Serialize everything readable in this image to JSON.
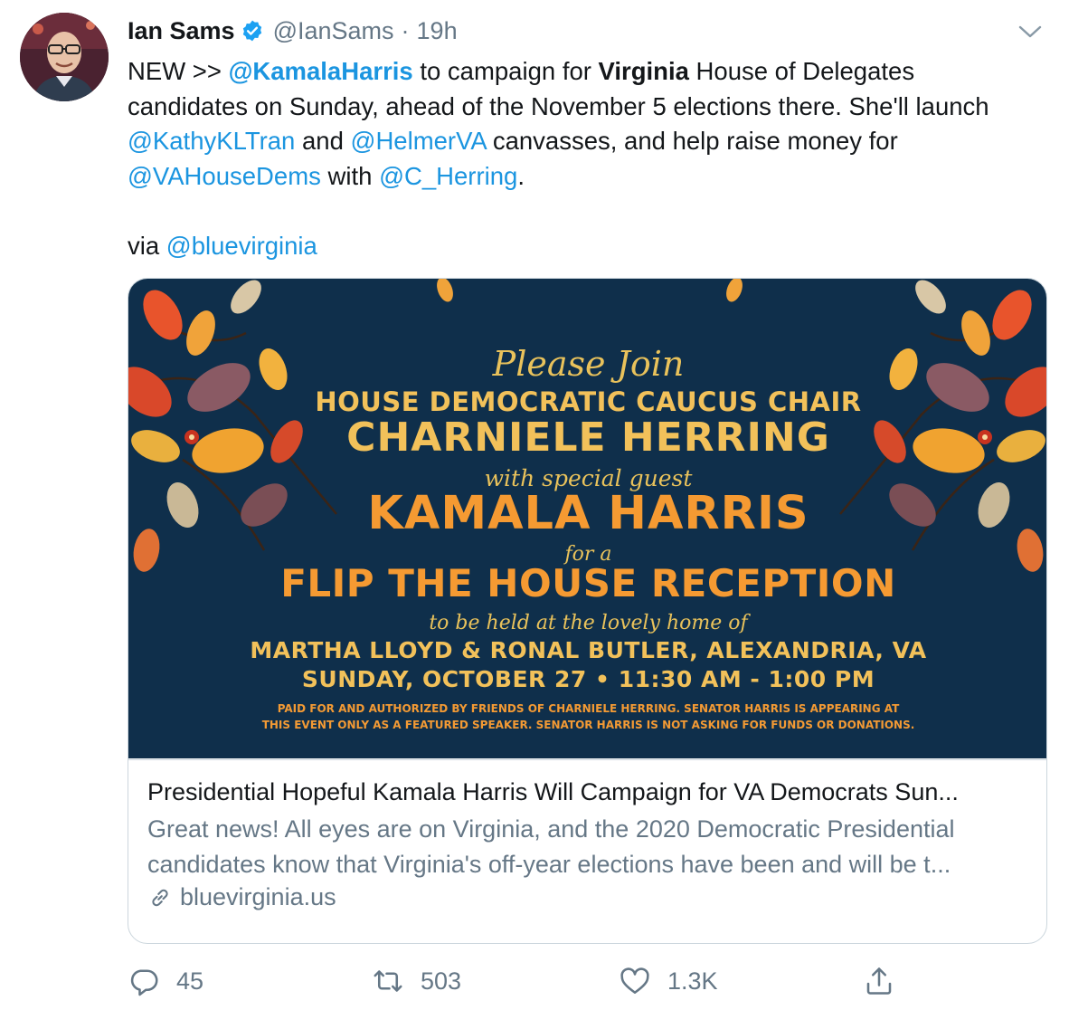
{
  "tweet": {
    "author": {
      "name": "Ian Sams",
      "handle": "@IanSams",
      "time": "19h"
    },
    "lines": {
      "l1": {
        "a": "NEW >> ",
        "mention1": "@KamalaHarris",
        "b": " to campaign for ",
        "bold": "Virginia",
        "c": " House of Delegates"
      },
      "l2": "candidates on Sunday, ahead of the November 5 elections there. She'll launch",
      "l3": {
        "mention1": "@KathyKLTran",
        "a": " and ",
        "mention2": "@HelmerVA",
        "b": " canvasses, and help raise money for"
      },
      "l4": {
        "mention1": "@VAHouseDems",
        "a": " with ",
        "mention2": "@C_Herring",
        "b": "."
      },
      "l5": {
        "a": "via ",
        "mention1": "@bluevirginia"
      }
    }
  },
  "flyer": {
    "please_join": "Please Join",
    "caucus_chair": "HOUSE DEMOCRATIC CAUCUS CHAIR",
    "host": "CHARNIELE HERRING",
    "special_guest": "with special guest",
    "guest": "KAMALA HARRIS",
    "for_a": "for a",
    "event": "FLIP THE HOUSE RECEPTION",
    "held_at": "to be held at the lovely home of",
    "hosts_home": "MARTHA LLOYD & RONAL BUTLER, ALEXANDRIA, VA",
    "datetime": "SUNDAY, OCTOBER 27 • 11:30 AM - 1:00 PM",
    "disclaimer1": "PAID FOR AND AUTHORIZED BY FRIENDS OF CHARNIELE HERRING. SENATOR HARRIS IS APPEARING AT",
    "disclaimer2": "THIS EVENT ONLY AS A FEATURED SPEAKER. SENATOR HARRIS IS NOT ASKING FOR FUNDS OR DONATIONS."
  },
  "card": {
    "title": "Presidential Hopeful Kamala Harris Will Campaign for VA Democrats Sun...",
    "desc1": "Great news! All eyes are on Virginia, and the 2020 Democratic Presidential",
    "desc2": "candidates know that Virginia's off-year elections have been and will be t...",
    "domain": "bluevirginia.us"
  },
  "actions": {
    "replies": "45",
    "retweets": "503",
    "likes": "1.3K"
  },
  "colors": {
    "link": "#1b95e0",
    "muted": "#657786",
    "flyer_bg": "#0f2f4b",
    "flyer_orange": "#f39a34",
    "flyer_gold": "#e9c25b"
  },
  "icons": [
    "verified-badge-icon",
    "chevron-down-icon",
    "link-icon",
    "reply-icon",
    "retweet-icon",
    "like-icon",
    "share-icon"
  ]
}
